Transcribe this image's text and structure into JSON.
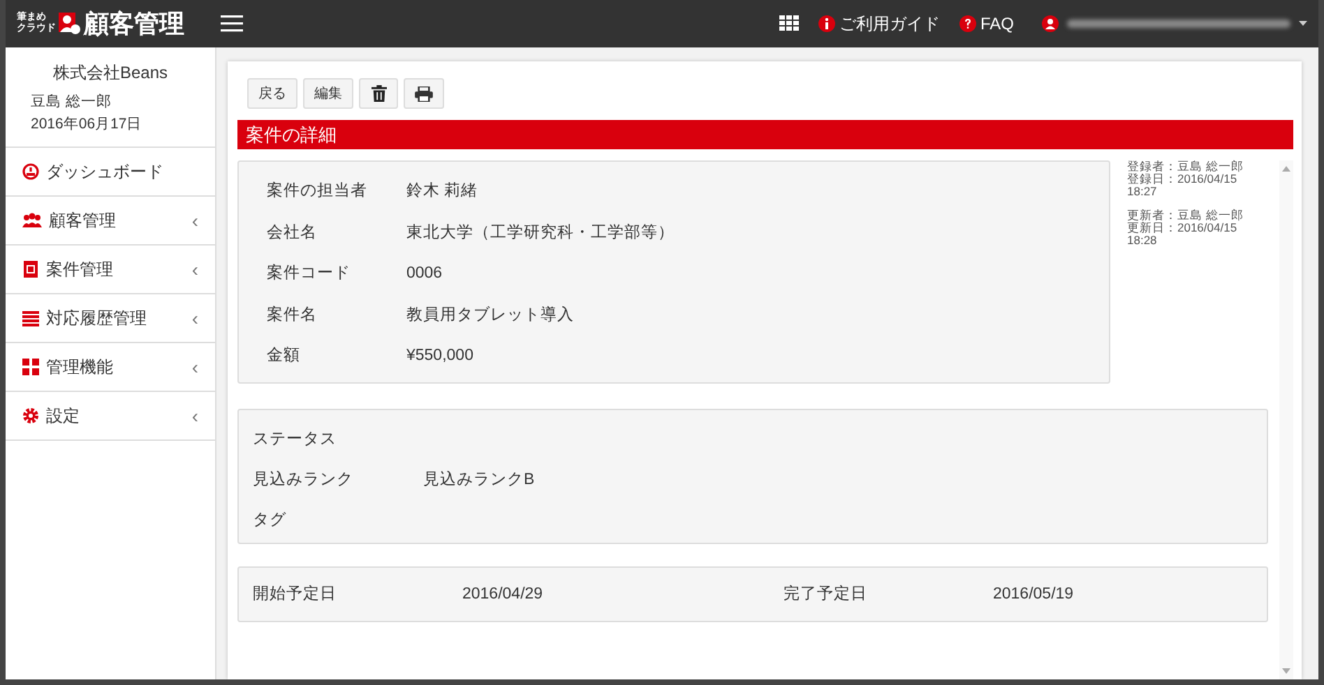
{
  "header": {
    "logo_small": [
      "筆まめ",
      "クラウド"
    ],
    "logo_title": "顧客管理",
    "nav": [
      {
        "kind": "guide",
        "label": "ご利用ガイド"
      },
      {
        "kind": "faq",
        "label": "FAQ"
      }
    ]
  },
  "sidebar": {
    "company": "株式会社Beans",
    "user": "豆島 総一郎",
    "date": "2016年06月17日",
    "items": [
      {
        "kind": "dashboard",
        "label": "ダッシュボード"
      },
      {
        "kind": "customers",
        "label": "顧客管理",
        "chevron": "‹"
      },
      {
        "kind": "cases",
        "label": "案件管理",
        "chevron": "‹"
      },
      {
        "kind": "history",
        "label": "対応履歴管理",
        "chevron": "‹"
      },
      {
        "kind": "admin",
        "label": "管理機能",
        "chevron": "‹"
      },
      {
        "kind": "settings",
        "label": "設定",
        "chevron": "‹"
      }
    ]
  },
  "toolbar": [
    {
      "kind": "text",
      "label": "戻る"
    },
    {
      "kind": "text",
      "label": "編集"
    },
    {
      "kind": "trash"
    },
    {
      "kind": "print"
    }
  ],
  "section_title": "案件の詳細",
  "details": [
    {
      "label": "案件の担当者",
      "value": "鈴木 莉緒"
    },
    {
      "label": "会社名",
      "value": "東北大学（工学研究科・工学部等）"
    },
    {
      "label": "案件コード",
      "value": "0006"
    },
    {
      "label": "案件名",
      "value": "教員用タブレット導入"
    },
    {
      "label": "金額",
      "value": "¥550,000"
    }
  ],
  "meta": [
    [
      "登録者：豆島 総一郎",
      "登録日：2016/04/15",
      "18:27"
    ],
    [
      "更新者：豆島 総一郎",
      "更新日：2016/04/15",
      "18:28"
    ]
  ],
  "status": [
    {
      "label": "ステータス"
    },
    {
      "label": "見込みランク",
      "value": "見込みランクB"
    },
    {
      "label": "タグ"
    }
  ],
  "dates": [
    {
      "label": "開始予定日",
      "value": "2016/04/29"
    },
    {
      "label": "完了予定日",
      "value": "2016/05/19"
    }
  ]
}
